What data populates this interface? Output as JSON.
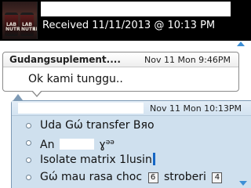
{
  "header": {
    "avatar_label": "LAB NUTRITION",
    "received": "Received 11/11/2013 @ 10:13 PM"
  },
  "incoming": {
    "sender": "Gudangsuplement....",
    "time": "Nov 11 Mon 9:46PM",
    "text": "Ok kami tunggu.."
  },
  "outgoing": {
    "time": "Nov 11 Mon 10:13PM",
    "line1": "Uda  Gώ transfer Bяo",
    "line2_prefix": "An",
    "line2_suffix": "ɣ",
    "line2_sup": "ǝǝ",
    "line3": "Isolate matrix 1lusin",
    "line4_text": "Gώ mau rasa choc",
    "line4_badge1": "6",
    "line4_text2": "stroberi",
    "line4_badge2": "4"
  },
  "colors": {
    "header_bg": "#000000",
    "outgoing_bg": "#cfe0ee",
    "scroll_arrow": "#3d8fd6",
    "caret": "#1566c4"
  }
}
